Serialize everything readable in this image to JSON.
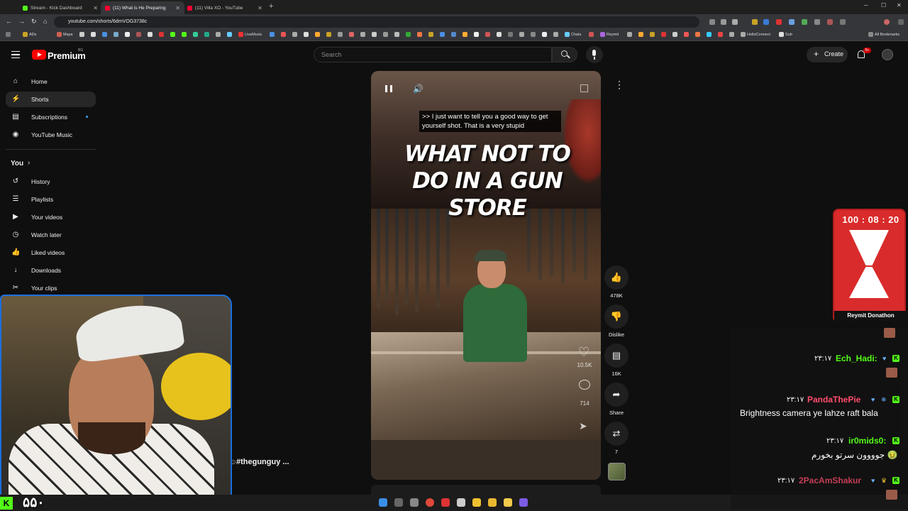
{
  "browser": {
    "tabs": [
      {
        "title": "Stream - Kick Dashboard",
        "color": "#53fc18"
      },
      {
        "title": "(11) What is He Preparing",
        "color": "#ff0033"
      },
      {
        "title": "(11) Villa XO - YouTube",
        "color": "#ff0033"
      }
    ],
    "url": "youtube.com/shorts/6dmVOG3738c",
    "bookmarks": [
      "ADs",
      "Maya",
      "LiveMusic",
      "Chats",
      "Reymit",
      "HelloConnect",
      "Sub",
      "All Bookmarks"
    ]
  },
  "yt": {
    "logo_text": "Premium",
    "country": "BG",
    "search_placeholder": "Search",
    "create_label": "Create",
    "notif_count": "9+",
    "sidebar": [
      {
        "label": "Home",
        "icon": "home-icon",
        "glyph": "⌂"
      },
      {
        "label": "Shorts",
        "icon": "shorts-icon",
        "glyph": "⚡"
      },
      {
        "label": "Subscriptions",
        "icon": "subscriptions-icon",
        "glyph": "▤"
      },
      {
        "label": "YouTube Music",
        "icon": "music-icon",
        "glyph": "◉"
      }
    ],
    "you_label": "You",
    "you_items": [
      {
        "label": "History",
        "icon": "history-icon",
        "glyph": "↺"
      },
      {
        "label": "Playlists",
        "icon": "playlists-icon",
        "glyph": "☰"
      },
      {
        "label": "Your videos",
        "icon": "your-videos-icon",
        "glyph": "▶"
      },
      {
        "label": "Watch later",
        "icon": "watch-later-icon",
        "glyph": "◷"
      },
      {
        "label": "Liked videos",
        "icon": "liked-videos-icon",
        "glyph": "👍"
      },
      {
        "label": "Downloads",
        "icon": "downloads-icon",
        "glyph": "↓"
      },
      {
        "label": "Your clips",
        "icon": "clips-icon",
        "glyph": "✂"
      }
    ]
  },
  "short": {
    "caption": ">> I just want to tell you a good way to get yourself shot. That is a very stupid",
    "title_line1": "WHAT NOT TO",
    "title_line2": "DO IN A GUN STORE",
    "overlay_likes": "10.5K",
    "overlay_comments": "714",
    "hashtag": "#thegunguy ...",
    "actions": {
      "likes": "478K",
      "dislike": "Dislike",
      "comments": "16K",
      "share": "Share",
      "remix": "7"
    }
  },
  "stream": {
    "viewer_count": "۵۵۰",
    "timer": "100 : 08 : 20",
    "timer_label": "Reymit Donathon"
  },
  "chat": [
    {
      "name": "Ech_Hadi:",
      "time": "۲۳:۱۷",
      "color": "#53fc18",
      "message": ""
    },
    {
      "name": "PandaThePie",
      "time": "۲۳:۱۷",
      "color": "#ff4d6d",
      "message": "Brightness camera ye lahze raft bala"
    },
    {
      "name": "ir0mids0:",
      "time": "۲۳:۱۷",
      "color": "#53fc18",
      "message": "جوووون سرتو بخورم 🤢"
    },
    {
      "name": "2PacAmShakur",
      "time": "۲۳:۱۷",
      "color": "#ff4d6d",
      "message": ""
    }
  ]
}
